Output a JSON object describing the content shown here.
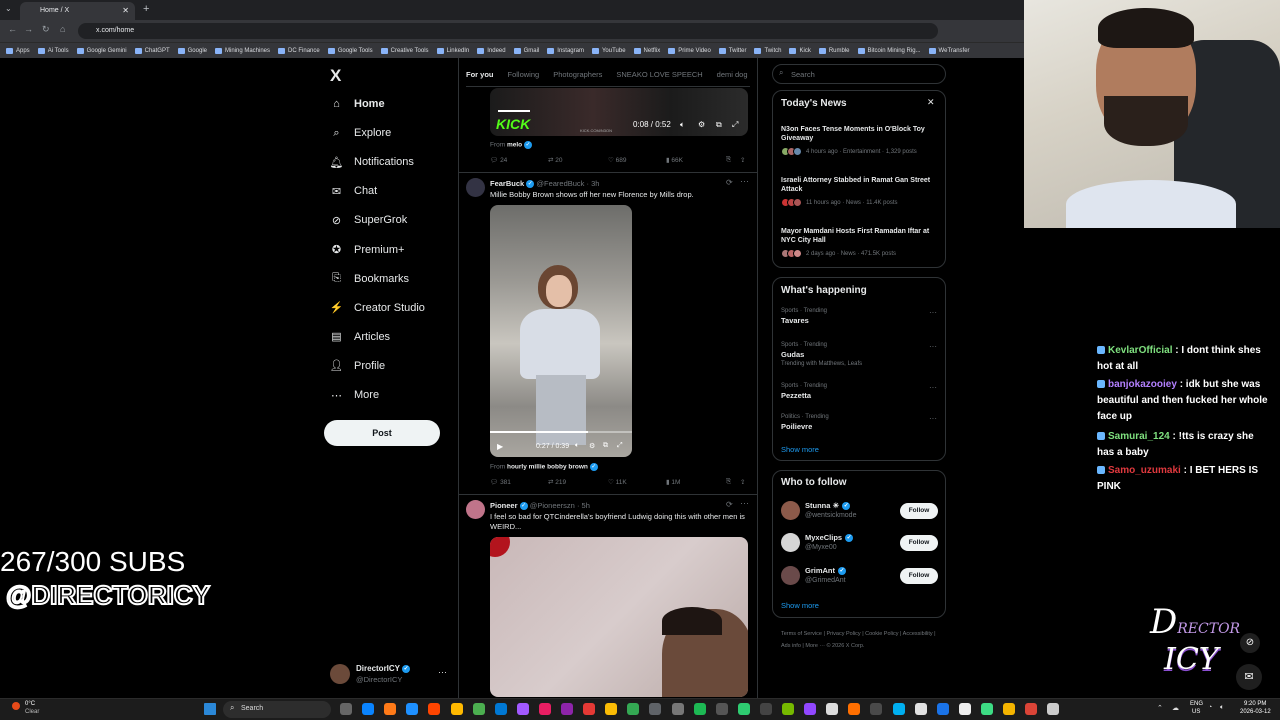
{
  "browser": {
    "tab_title": "Home / X",
    "url": "x.com/home",
    "bookmarks": [
      "Apps",
      "Ai Tools",
      "Google Gemini",
      "ChatGPT",
      "Google",
      "Mining Machines",
      "DC Finance",
      "Google Tools",
      "Creative Tools",
      "LinkedIn",
      "Indeed",
      "Gmail",
      "Instagram",
      "YouTube",
      "Netflix",
      "Prime Video",
      "Twitter",
      "Twitch",
      "Kick",
      "Rumble",
      "Bitcoin Mining Rig...",
      "WeTransfer"
    ]
  },
  "nav": {
    "logo": "X",
    "items": [
      {
        "label": "Home",
        "icon": "home-icon"
      },
      {
        "label": "Explore",
        "icon": "search-icon"
      },
      {
        "label": "Notifications",
        "icon": "bell-icon"
      },
      {
        "label": "Chat",
        "icon": "mail-icon"
      },
      {
        "label": "SuperGrok",
        "icon": "grok-icon"
      },
      {
        "label": "Premium+",
        "icon": "premium-icon"
      },
      {
        "label": "Bookmarks",
        "icon": "bookmark-icon"
      },
      {
        "label": "Creator Studio",
        "icon": "studio-icon"
      },
      {
        "label": "Articles",
        "icon": "article-icon"
      },
      {
        "label": "Profile",
        "icon": "person-icon"
      },
      {
        "label": "More",
        "icon": "more-icon"
      }
    ],
    "post_label": "Post",
    "account": {
      "name": "DirectorICY",
      "handle": "@DirectorICY"
    }
  },
  "feed": {
    "tabs": [
      "For you",
      "Following",
      "Photographers",
      "SNEAKO LOVE SPEECH",
      "demi dog"
    ],
    "post1": {
      "video_time": "0:08 / 0:52",
      "video_brand": "KICK",
      "video_url": "KICK.COM/N3ON",
      "from_prefix": "From",
      "from_name": "melo",
      "stats": {
        "replies": "24",
        "reposts": "20",
        "likes": "689",
        "views": "66K"
      }
    },
    "post2": {
      "name": "FearBuck",
      "handle": "@FearedBuck",
      "time": "3h",
      "text": "Millie Bobby Brown shows off her new Florence by Mills drop.",
      "video_time": "0:27 / 0:39",
      "from_prefix": "From",
      "from_name": "hourly millie bobby brown",
      "stats": {
        "replies": "381",
        "reposts": "219",
        "likes": "11K",
        "views": "1M"
      }
    },
    "post3": {
      "name": "Pioneer",
      "handle": "@Pioneerszn",
      "time": "5h",
      "text": "I feel so bad for QTCinderella's boyfriend Ludwig doing this with other men is WEIRD..."
    }
  },
  "sidebar": {
    "search_placeholder": "Search",
    "news_title": "Today's News",
    "news": [
      {
        "headline": "N3on Faces Tense Moments in O'Block Toy Giveaway",
        "meta": "4 hours ago · Entertainment · 1,329 posts"
      },
      {
        "headline": "Israeli Attorney Stabbed in Ramat Gan Street Attack",
        "meta": "11 hours ago · News · 11.4K posts"
      },
      {
        "headline": "Mayor Mamdani Hosts First Ramadan Iftar at NYC City Hall",
        "meta": "2 days ago · News · 471.5K posts"
      }
    ],
    "happening_title": "What's happening",
    "trends": [
      {
        "category": "Sports · Trending",
        "name": "Tavares",
        "extra": ""
      },
      {
        "category": "Sports · Trending",
        "name": "Gudas",
        "extra": "Trending with Matthews, Leafs"
      },
      {
        "category": "Sports · Trending",
        "name": "Pezzetta",
        "extra": ""
      },
      {
        "category": "Politics · Trending",
        "name": "Poilievre",
        "extra": ""
      }
    ],
    "show_more": "Show more",
    "wtf_title": "Who to follow",
    "wtf": [
      {
        "name": "Stunna ☀",
        "handle": "@wentsickmode"
      },
      {
        "name": "MyxeClips",
        "handle": "@Myxe00"
      },
      {
        "name": "GrimAnt",
        "handle": "@GrimedAnt"
      }
    ],
    "follow_label": "Follow",
    "footer": "Terms of Service | Privacy Policy | Cookie Policy | Accessibility | Ads info | More ··· © 2026 X Corp."
  },
  "overlay": {
    "subs": "267/300 SUBS",
    "handle": "@DIRECTORICY",
    "logo_text": "DIRECTOR ICY"
  },
  "chat": [
    {
      "user": "KevlarOfficial",
      "color": "#7fe07f",
      "message": ": I dont think shes hot at all"
    },
    {
      "user": "banjokazooiey",
      "color": "#b380ff",
      "message": ": idk but she was beautiful and then fucked her whole face up"
    },
    {
      "user": "Samurai_124",
      "color": "#7fe07f",
      "message": ": !tts is crazy she has a baby"
    },
    {
      "user": "Samo_uzumaki",
      "color": "#e0393e",
      "message": ": I BET HERS IS PINK"
    }
  ],
  "taskbar": {
    "weather_temp": "0°C",
    "weather_desc": "Clear",
    "search": "Search",
    "lang": "ENG",
    "region": "US",
    "time": "9:20 PM",
    "date": "2026-03-12"
  },
  "colors": {
    "accent": "#1d9bf0",
    "bg": "#000000",
    "border": "#2f3336"
  }
}
